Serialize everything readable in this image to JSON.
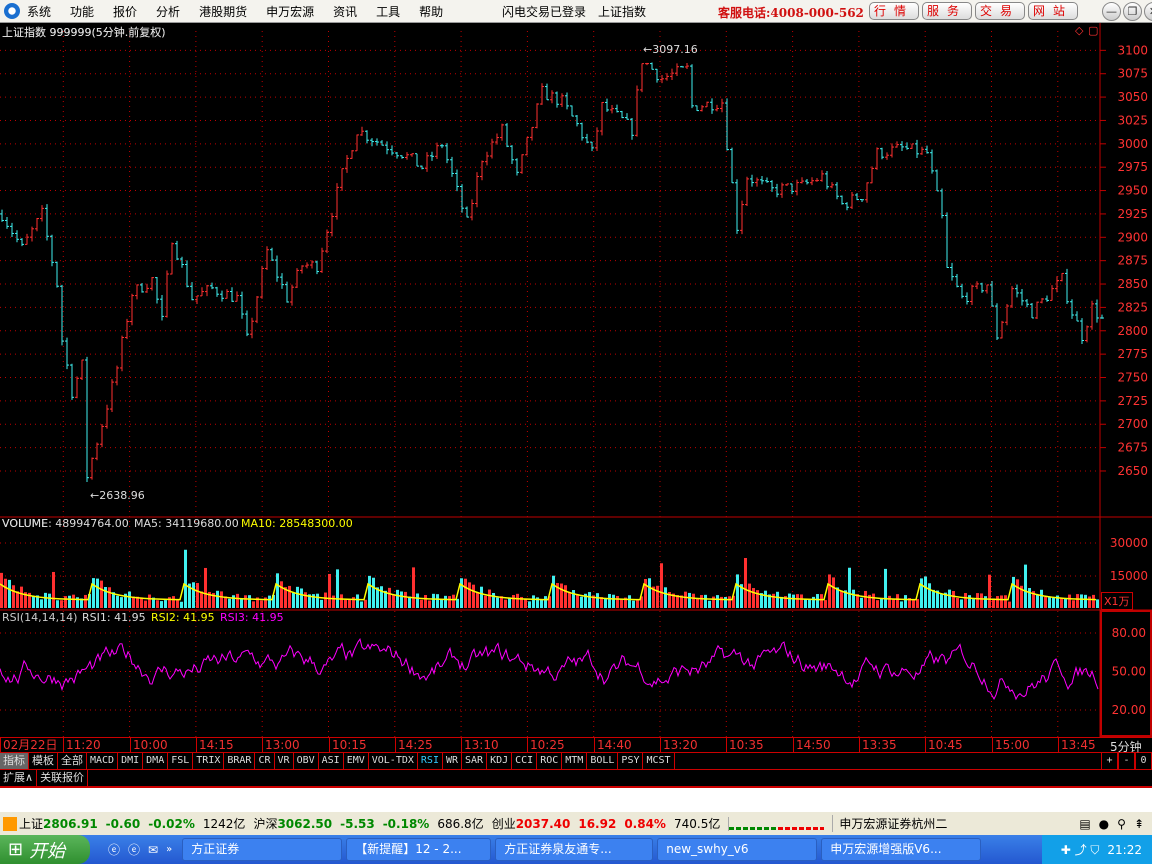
{
  "menubar": {
    "items": [
      "系统",
      "功能",
      "报价",
      "分析",
      "港股期货",
      "申万宏源",
      "资讯",
      "工具",
      "帮助"
    ],
    "login_status": "闪电交易已登录",
    "current_index": "上证指数",
    "hotline": "客服电话:4008-000-562",
    "service_buttons": [
      "行情",
      "服务",
      "交易",
      "网站"
    ]
  },
  "chart_header": "上证指数 999999(5分钟.前复权)",
  "colors": {
    "up": "#ff3030",
    "down": "#40f0f0",
    "grid": "#c00000",
    "ma10": "#ffff00",
    "rsi": "#ff00ff"
  },
  "chart_data": [
    {
      "type": "candlestick",
      "title": "上证指数 999999(5分钟.前复权)",
      "ylim": [
        2635,
        3110
      ],
      "y_ticks": [
        3100,
        3075,
        3050,
        3025,
        3000,
        2975,
        2950,
        2925,
        2900,
        2875,
        2850,
        2825,
        2800,
        2775,
        2750,
        2725,
        2700,
        2675,
        2650
      ],
      "high_label": "3097.16",
      "low_label": "2638.96",
      "path": [
        [
          0,
          2925
        ],
        [
          4,
          2888
        ],
        [
          8,
          2925
        ],
        [
          11,
          2850
        ],
        [
          12,
          2790
        ],
        [
          14,
          2735
        ],
        [
          16,
          2763
        ],
        [
          17,
          2645
        ],
        [
          20,
          2700
        ],
        [
          23,
          2760
        ],
        [
          26,
          2840
        ],
        [
          30,
          2855
        ],
        [
          32,
          2810
        ],
        [
          34,
          2900
        ],
        [
          38,
          2835
        ],
        [
          42,
          2845
        ],
        [
          47,
          2835
        ],
        [
          49,
          2790
        ],
        [
          53,
          2885
        ],
        [
          57,
          2835
        ],
        [
          60,
          2870
        ],
        [
          63,
          2870
        ],
        [
          68,
          2967
        ],
        [
          71,
          3015
        ],
        [
          76,
          3000
        ],
        [
          80,
          2990
        ],
        [
          84,
          2975
        ],
        [
          88,
          3000
        ],
        [
          93,
          2915
        ],
        [
          96,
          2985
        ],
        [
          100,
          3015
        ],
        [
          103,
          2965
        ],
        [
          108,
          3055
        ],
        [
          112,
          3045
        ],
        [
          115,
          3020
        ],
        [
          118,
          2990
        ],
        [
          120,
          3040
        ],
        [
          124,
          3025
        ],
        [
          126,
          3015
        ],
        [
          128,
          3090
        ],
        [
          132,
          3070
        ],
        [
          137,
          3080
        ],
        [
          138,
          3040
        ],
        [
          144,
          3045
        ],
        [
          147,
          2912
        ],
        [
          149,
          2965
        ],
        [
          154,
          2950
        ],
        [
          160,
          2955
        ],
        [
          164,
          2965
        ],
        [
          168,
          2935
        ],
        [
          172,
          2945
        ],
        [
          175,
          2990
        ],
        [
          180,
          2995
        ],
        [
          185,
          2990
        ],
        [
          188,
          2920
        ],
        [
          189,
          2865
        ],
        [
          192,
          2835
        ],
        [
          197,
          2850
        ],
        [
          199,
          2795
        ],
        [
          202,
          2845
        ],
        [
          206,
          2820
        ],
        [
          212,
          2855
        ],
        [
          214,
          2820
        ],
        [
          216,
          2795
        ],
        [
          218,
          2825
        ],
        [
          220,
          2812
        ]
      ]
    },
    {
      "type": "bar",
      "title": "VOLUME",
      "volume_label": "VOLUME: 48994764.00",
      "ma5_label": "MA5: 34119680.00",
      "ma10_label": "MA10: 28548300.00",
      "y_ticks": [
        "30000",
        "15000"
      ],
      "unit": "X1万"
    },
    {
      "type": "line",
      "title": "RSI(14,14,14)",
      "rsi1_label": "RSI1: 41.95",
      "rsi2_label": "RSI2: 41.95",
      "rsi3_label": "RSI3: 41.95",
      "y_ticks": [
        "80.00",
        "50.00",
        "20.00"
      ]
    }
  ],
  "time_axis": [
    "02月22日",
    "11:20",
    "10:00",
    "14:15",
    "13:00",
    "10:15",
    "14:25",
    "13:10",
    "10:25",
    "14:40",
    "13:20",
    "10:35",
    "14:50",
    "13:35",
    "10:45",
    "15:00",
    "13:45"
  ],
  "period": "5分钟",
  "zoom_buttons": [
    "+",
    "-",
    "0"
  ],
  "indicator_tabs": [
    "指标",
    "模板",
    "全部",
    "MACD",
    "DMI",
    "DMA",
    "FSL",
    "TRIX",
    "BRAR",
    "CR",
    "VR",
    "OBV",
    "ASI",
    "EMV",
    "VOL-TDX",
    "RSI",
    "WR",
    "SAR",
    "KDJ",
    "CCI",
    "ROC",
    "MTM",
    "BOLL",
    "PSY",
    "MCST"
  ],
  "ext_tabs": [
    "扩展∧",
    "关联报价"
  ],
  "status": {
    "sh_label": "上证",
    "sh_value": "2806.91",
    "sh_change": "-0.60",
    "sh_pct": "-0.02%",
    "sh_amount": "1242亿",
    "hs_label": "沪深",
    "hs_value": "3062.50",
    "hs_change": "-5.53",
    "hs_pct": "-0.18%",
    "hs_amount": "686.8亿",
    "cy_label": "创业",
    "cy_value": "2037.40",
    "cy_change": "16.92",
    "cy_pct": "0.84%",
    "cy_amount": "740.5亿",
    "broker": "申万宏源证券杭州二"
  },
  "taskbar": {
    "start": "开始",
    "tasks": [
      "方正证券",
      "【新提醒】12 - 2...",
      "方正证券泉友通专...",
      "new_swhy_v6",
      "申万宏源增强版V6..."
    ],
    "clock": "21:22"
  }
}
